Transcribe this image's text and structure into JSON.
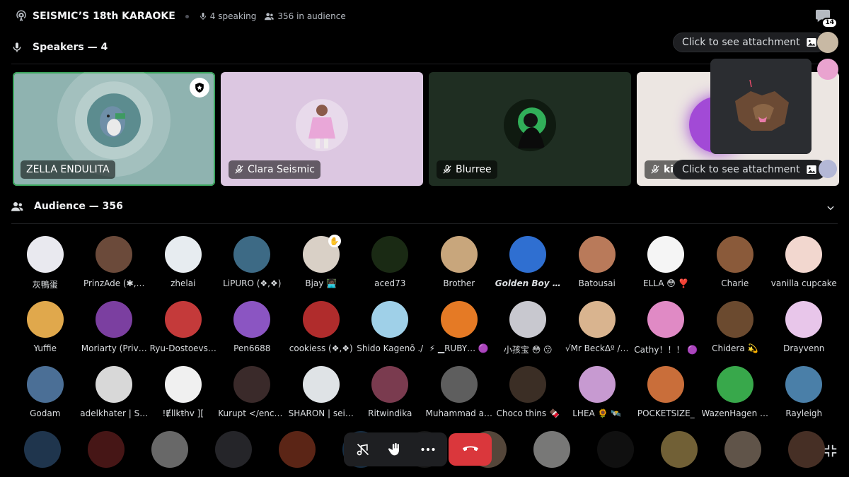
{
  "header": {
    "title": "SEISMIC’S 18th KARAOKE",
    "speaking": "4 speaking",
    "audience_count": "356 in audience",
    "chat_badge": "14"
  },
  "speakers_section": {
    "label": "Speakers — 4"
  },
  "speakers": [
    {
      "name": "ZELLA ENDULITA",
      "bg": "#8fb3b0",
      "muted": false,
      "moderator": true,
      "active": true
    },
    {
      "name": "Clara Seismic",
      "bg": "#dcc7e1",
      "muted": true,
      "moderator": false,
      "active": false
    },
    {
      "name": "Blurree",
      "bg": "#1f2e22",
      "muted": true,
      "moderator": false,
      "active": false
    },
    {
      "name": "kit",
      "bg": "#ece6e2",
      "muted": true,
      "moderator": false,
      "active": false
    }
  ],
  "attachment_label": "Click to see attachment",
  "audience_section": {
    "label": "Audience — 356"
  },
  "audience": [
    [
      {
        "name": "灰鴨蛋",
        "color": "#e9e9ef"
      },
      {
        "name": "PrinzAde (✱,…",
        "color": "#6b4a3a"
      },
      {
        "name": "zhelai",
        "color": "#e7ecf0"
      },
      {
        "name": "LiPURO (❖,❖)",
        "color": "#3d6a85"
      },
      {
        "name": "Bjay 🧑🏿‍💻",
        "color": "#d9d0c6",
        "hand": true
      },
      {
        "name": "aced73",
        "color": "#1a2a14"
      },
      {
        "name": "Brother",
        "color": "#c8a67c"
      },
      {
        "name": "Golden Boy …",
        "color": "#2f6fd1",
        "bold": true
      },
      {
        "name": "Batousai",
        "color": "#b97a5a"
      },
      {
        "name": "ELLA 😳 ❣️",
        "color": "#f5f5f5"
      },
      {
        "name": "Charie",
        "color": "#8a5a3a"
      },
      {
        "name": "vanilla cupcake",
        "color": "#f2d7cf"
      }
    ],
    [
      {
        "name": "Yuffie",
        "color": "#e0a84c"
      },
      {
        "name": "Moriarty (Priv…",
        "color": "#7b3fa0"
      },
      {
        "name": "Ryu-Dostoevs…",
        "color": "#c43a3a"
      },
      {
        "name": "Pen6688",
        "color": "#8b55c2"
      },
      {
        "name": "cookiess (❖,❖)",
        "color": "#b02c2c"
      },
      {
        "name": "Shido Kagenō ./",
        "color": "#9fd0e8"
      },
      {
        "name": "⚡ ▁RUBY… 🟣",
        "color": "#e57a25"
      },
      {
        "name": "小孩宝 😳 😗",
        "color": "#c8c8cf"
      },
      {
        "name": "√Mr BeckΔº /…",
        "color": "#d9b48f"
      },
      {
        "name": "Cathy！！！ 🟣",
        "color": "#e08ac5"
      },
      {
        "name": "Chidera 💫",
        "color": "#6b4a2f"
      },
      {
        "name": "Drayvenn",
        "color": "#e8c6ea"
      }
    ],
    [
      {
        "name": "Godam",
        "color": "#4b6f96"
      },
      {
        "name": "adelkhater | S…",
        "color": "#d8d8d8"
      },
      {
        "name": "!Ɇllkŧhv ]​[",
        "color": "#f0f0f0"
      },
      {
        "name": "Kurupt </encr…",
        "color": "#3a2a2a"
      },
      {
        "name": "SHARON | sei…",
        "color": "#dfe3e6"
      },
      {
        "name": "Ritwindika",
        "color": "#7a3b4f"
      },
      {
        "name": "Muhammad a…",
        "color": "#5e5e5e"
      },
      {
        "name": "Choco thins 🍫",
        "color": "#3b2e25"
      },
      {
        "name": "LHEA 🌻 🛰️",
        "color": "#c79ad1"
      },
      {
        "name": "POCKETSIZE_",
        "color": "#c96e3a"
      },
      {
        "name": "WazenHagen …",
        "color": "#38a84b"
      },
      {
        "name": "Rayleigh",
        "color": "#4a7fa8"
      }
    ],
    [
      {
        "name": "",
        "color": "#3e6a9a"
      },
      {
        "name": "",
        "color": "#8c2b2b"
      },
      {
        "name": "",
        "color": "#cfcfcf"
      },
      {
        "name": "",
        "color": "#4a4a52"
      },
      {
        "name": "",
        "color": "#b6492b"
      },
      {
        "name": "",
        "color": "#2c5b87"
      },
      {
        "name": "",
        "color": "#2b2b2b"
      },
      {
        "name": "",
        "color": "#a88b73"
      },
      {
        "name": "",
        "color": "#f0efee"
      },
      {
        "name": "",
        "color": "#1f1f1f"
      },
      {
        "name": "",
        "color": "#e2c06b"
      },
      {
        "name": "",
        "color": "#bfa891"
      },
      {
        "name": "",
        "color": "#8b5e4a"
      }
    ]
  ],
  "colors": {
    "active_border": "#3ba55d",
    "leave": "#da373c"
  }
}
